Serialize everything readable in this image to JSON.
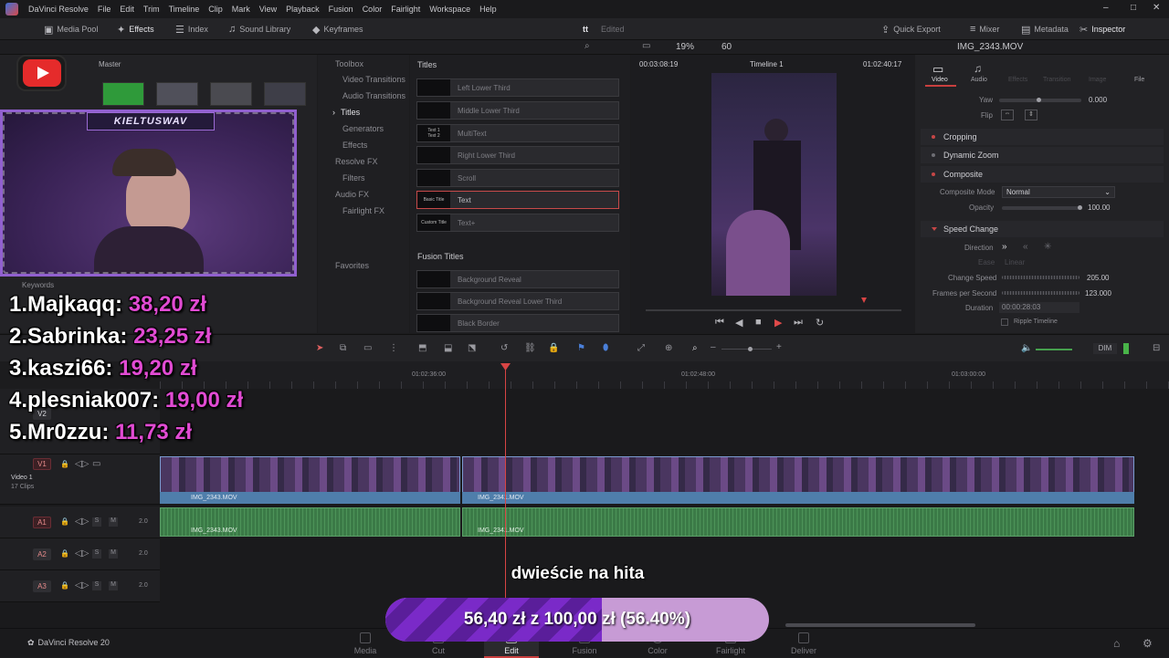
{
  "app": {
    "menu": [
      "DaVinci Resolve",
      "File",
      "Edit",
      "Trim",
      "Timeline",
      "Clip",
      "Mark",
      "View",
      "Playback",
      "Fusion",
      "Color",
      "Fairlight",
      "Workspace",
      "Help"
    ],
    "window_controls": [
      "–",
      "□",
      "✕"
    ]
  },
  "toolbar": {
    "media_pool": "Media Pool",
    "effects": "Effects",
    "index": "Index",
    "sound_library": "Sound Library",
    "keyframes": "Keyframes",
    "timeline_name_short": "tt",
    "status": "Edited",
    "quick_export": "Quick Export",
    "mixer": "Mixer",
    "metadata": "Metadata",
    "inspector": "Inspector"
  },
  "subbar": {
    "zoom": "19%",
    "fps": "60",
    "clip_name": "IMG_2343.MOV"
  },
  "media_pool": {
    "bin": "Master",
    "keywords_label": "Keywords"
  },
  "effects_tree": {
    "toolbox": "Toolbox",
    "video_transitions": "Video Transitions",
    "audio_transitions": "Audio Transitions",
    "titles": "Titles",
    "generators": "Generators",
    "effects": "Effects",
    "resolve_fx": "Resolve FX",
    "filters": "Filters",
    "audio_fx": "Audio FX",
    "fairlight_fx": "Fairlight FX",
    "favorites": "Favorites"
  },
  "titles_panel": {
    "header": "Titles",
    "items": [
      {
        "thumb": "",
        "label": "Left Lower Third"
      },
      {
        "thumb": "",
        "label": "Middle Lower Third"
      },
      {
        "thumb": "Text 1\nText 2",
        "label": "MultiText"
      },
      {
        "thumb": "",
        "label": "Right Lower Third"
      },
      {
        "thumb": "",
        "label": "Scroll"
      },
      {
        "thumb": "Basic Title",
        "label": "Text"
      },
      {
        "thumb": "Custom Title",
        "label": "Text+"
      }
    ],
    "fusion_header": "Fusion Titles",
    "fusion_items": [
      {
        "thumb": "",
        "label": "Background Reveal"
      },
      {
        "thumb": "",
        "label": "Background Reveal Lower Third"
      },
      {
        "thumb": "",
        "label": "Black Border"
      }
    ]
  },
  "viewer": {
    "timecode_left": "00:03:08:19",
    "timeline_name": "Timeline 1",
    "timecode_right": "01:02:40:17"
  },
  "inspector": {
    "tabs": [
      "Video",
      "Audio",
      "Effects",
      "Transition",
      "Image",
      "File"
    ],
    "yaw_label": "Yaw",
    "yaw_value": "0.000",
    "flip_label": "Flip",
    "cropping": "Cropping",
    "dynamic_zoom": "Dynamic Zoom",
    "composite": "Composite",
    "composite_mode_label": "Composite Mode",
    "composite_mode_value": "Normal",
    "opacity_label": "Opacity",
    "opacity_value": "100.00",
    "speed_change": "Speed Change",
    "direction_label": "Direction",
    "ease_label": "Ease",
    "ease_value": "Linear",
    "change_speed_label": "Change Speed",
    "change_speed_value": "205.00",
    "fps_label": "Frames per Second",
    "fps_value": "123.000",
    "duration_label": "Duration",
    "duration_value": "00:00:28:03",
    "ripple_label": "Ripple Timeline"
  },
  "timeline": {
    "dim": "DIM",
    "ruler": [
      "01:02:36:00",
      "01:02:48:00",
      "01:03:00:00"
    ],
    "tracks": {
      "v1": "V1",
      "video1_name": "Video 1",
      "video1_clips": "17 Clips",
      "v2": "V2",
      "a1": "A1",
      "a2": "A2",
      "a3": "A3",
      "audio_level": "2.0",
      "solo": "S",
      "mute": "M"
    },
    "clip_name": "IMG_2343.MOV",
    "clip_name_2": "IMG_2341.MOV"
  },
  "pages": [
    "Media",
    "Cut",
    "Edit",
    "Fusion",
    "Color",
    "Fairlight",
    "Deliver"
  ],
  "active_page": "Edit",
  "footer_app": "DaVinci Resolve 20",
  "overlay": {
    "nickname": "KIELTUSWAV",
    "donations": [
      {
        "rank": "1.",
        "name": "Majkaqq:",
        "amount": "38,20 zł"
      },
      {
        "rank": "2.",
        "name": "Sabrinka:",
        "amount": "23,25 zł"
      },
      {
        "rank": "3.",
        "name": "kaszi66:",
        "amount": "19,20 zł"
      },
      {
        "rank": "4.",
        "name": "plesniak007:",
        "amount": "19,00 zł"
      },
      {
        "rank": "5.",
        "name": "Mr0zzu:",
        "amount": "11,73 zł"
      }
    ],
    "goal_title": "dwieście na hita",
    "goal_text": "56,40 zł  z  100,00 zł (56.40%)",
    "goal_progress": 0.564
  }
}
